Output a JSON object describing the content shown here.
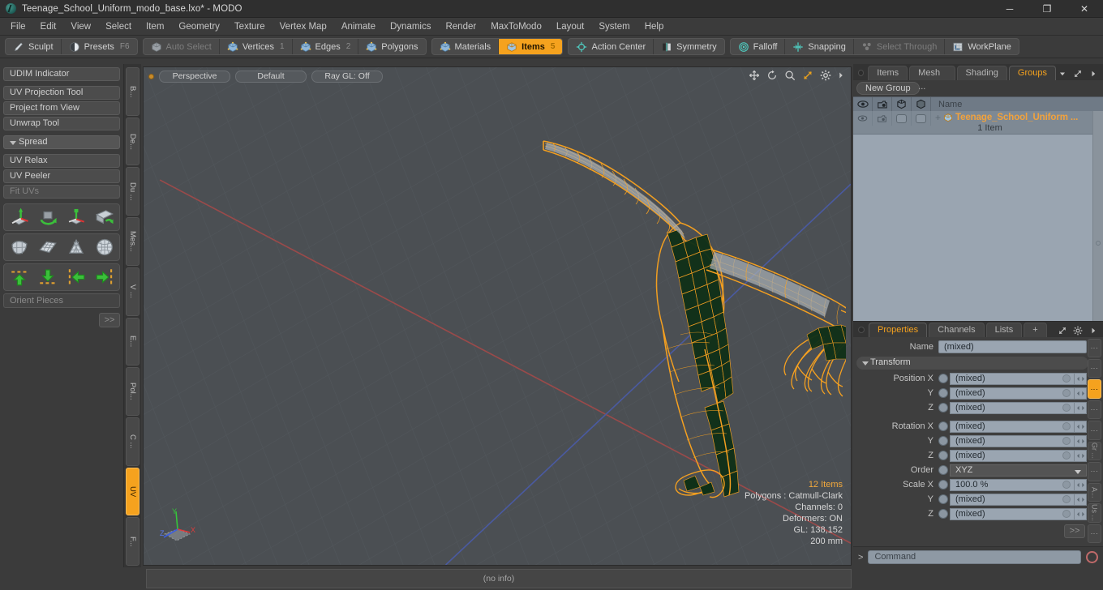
{
  "window": {
    "title": "Teenage_School_Uniform_modo_base.lxo* - MODO",
    "minimize": "─",
    "maximize": "❐",
    "close": "✕"
  },
  "menu": {
    "items": [
      "File",
      "Edit",
      "View",
      "Select",
      "Item",
      "Geometry",
      "Texture",
      "Vertex Map",
      "Animate",
      "Dynamics",
      "Render",
      "MaxToModo",
      "Layout",
      "System",
      "Help"
    ]
  },
  "modebar": {
    "group1": [
      {
        "label": "Sculpt",
        "icon": "brush-icon",
        "state": "normal",
        "count": ""
      },
      {
        "label": "Presets",
        "icon": "sphere-icon",
        "state": "normal",
        "count": "F6"
      }
    ],
    "group2": [
      {
        "label": "Auto Select",
        "icon": "cube-gray-icon",
        "state": "disabled",
        "count": ""
      },
      {
        "label": "Vertices",
        "icon": "cube-blue-icon",
        "state": "normal",
        "count": "1"
      },
      {
        "label": "Edges",
        "icon": "cube-blue-icon",
        "state": "normal",
        "count": "2"
      },
      {
        "label": "Polygons",
        "icon": "cube-blue-icon",
        "state": "normal",
        "count": ""
      }
    ],
    "group3": [
      {
        "label": "Materials",
        "icon": "cube-blue-icon",
        "state": "normal",
        "count": ""
      },
      {
        "label": "Items",
        "icon": "cube-orange-icon",
        "state": "active",
        "count": "5"
      }
    ],
    "group4": [
      {
        "label": "Action Center",
        "icon": "target-icon",
        "state": "normal",
        "count": ""
      },
      {
        "label": "Symmetry",
        "icon": "symmetry-icon",
        "state": "normal",
        "count": ""
      }
    ],
    "group5": [
      {
        "label": "Falloff",
        "icon": "falloff-icon",
        "state": "normal",
        "count": ""
      },
      {
        "label": "Snapping",
        "icon": "snap-icon",
        "state": "normal",
        "count": ""
      },
      {
        "label": "Select Through",
        "icon": "select-through-icon",
        "state": "disabled",
        "count": ""
      },
      {
        "label": "WorkPlane",
        "icon": "workplane-icon",
        "state": "normal",
        "count": ""
      }
    ]
  },
  "left_panel": {
    "buttons": [
      {
        "label": "UDIM Indicator",
        "dim": false,
        "gap_after": true
      },
      {
        "label": "UV Projection Tool",
        "dim": false,
        "gap_after": false
      },
      {
        "label": "Project from View",
        "dim": false,
        "gap_after": false
      },
      {
        "label": "Unwrap Tool",
        "dim": false,
        "gap_after": true
      }
    ],
    "group_header": "Spread",
    "buttons2": [
      {
        "label": "UV Relax",
        "dim": false
      },
      {
        "label": "UV Peeler",
        "dim": false
      },
      {
        "label": "Fit UVs",
        "dim": true
      }
    ],
    "icon_rows": [
      [
        "move-gizmo-icon",
        "rotate-icon",
        "scale-gizmo-icon",
        "fold-icon"
      ],
      [
        "unwrap-mesh-icon",
        "uv-grid-icon",
        "cone-unwrap-icon",
        "sphere-unwrap-icon"
      ],
      [
        "align-up-icon",
        "align-down-icon",
        "align-left-icon",
        "align-right-icon"
      ]
    ],
    "field_placeholder": "Orient Pieces",
    "more_label": ">>",
    "vtabs": [
      {
        "label": "B...",
        "active": false
      },
      {
        "label": "De...",
        "active": false
      },
      {
        "label": "Du ...",
        "active": false
      },
      {
        "label": "Mes...",
        "active": false
      },
      {
        "label": "V ...",
        "active": false
      },
      {
        "label": "E...",
        "active": false
      },
      {
        "label": "Pol...",
        "active": false
      },
      {
        "label": "C ...",
        "active": false
      },
      {
        "label": "UV",
        "active": true
      },
      {
        "label": "F...",
        "active": false
      }
    ]
  },
  "viewport": {
    "view_mode": "Perspective",
    "shading": "Default",
    "raygl": "Ray GL: Off",
    "tools": [
      "move-view-icon",
      "rotate-view-icon",
      "zoom-view-icon",
      "fit-view-icon",
      "gear-icon",
      "chevron-right-icon"
    ],
    "stats": {
      "items": "12 Items",
      "polygons": "Polygons : Catmull-Clark",
      "channels": "Channels: 0",
      "deformers": "Deformers: ON",
      "gl": "GL: 138,152",
      "scale": "200 mm"
    },
    "axis": {
      "x": "X",
      "y": "Y",
      "z": "Z"
    }
  },
  "right_panel": {
    "top_tabs": [
      {
        "label": "Items",
        "active": false
      },
      {
        "label": "Mesh ...",
        "active": false
      },
      {
        "label": "Shading",
        "active": false
      },
      {
        "label": "Groups",
        "active": true
      }
    ],
    "top_tab_extras": [
      "chevron-down-icon",
      "expand-icon",
      "chevron-right-icon"
    ],
    "new_group_label": "New Group",
    "list": {
      "columns": [
        "eye-icon",
        "render-icon",
        "wire-icon",
        "shade-icon",
        "Name"
      ],
      "name_header": "Name",
      "rows": [
        {
          "name": "Teenage_School_Uniform ...",
          "sub": "1 Item",
          "expander": "+"
        }
      ]
    },
    "bottom_tabs": [
      {
        "label": "Properties",
        "active": true
      },
      {
        "label": "Channels",
        "active": false
      },
      {
        "label": "Lists",
        "active": false
      },
      {
        "label": "+",
        "active": false
      }
    ],
    "bottom_tab_extras": [
      "expand-icon",
      "gear-icon",
      "chevron-right-icon"
    ],
    "properties": {
      "name_label": "Name",
      "name_value": "(mixed)",
      "transform_header": "Transform",
      "rows": [
        {
          "label": "Position X",
          "value": "(mixed)",
          "type": "value"
        },
        {
          "label": "Y",
          "value": "(mixed)",
          "type": "value"
        },
        {
          "label": "Z",
          "value": "(mixed)",
          "type": "value"
        },
        {
          "label": "Rotation X",
          "value": "(mixed)",
          "type": "value",
          "spacer_before": true
        },
        {
          "label": "Y",
          "value": "(mixed)",
          "type": "value"
        },
        {
          "label": "Z",
          "value": "(mixed)",
          "type": "value"
        },
        {
          "label": "Order",
          "value": "XYZ",
          "type": "select"
        },
        {
          "label": "Scale X",
          "value": "100.0 %",
          "type": "value"
        },
        {
          "label": "Y",
          "value": "(mixed)",
          "type": "value"
        },
        {
          "label": "Z",
          "value": "(mixed)",
          "type": "value"
        }
      ],
      "more_label": ">>"
    },
    "vtabs": [
      {
        "label": "⋮",
        "active": false
      },
      {
        "label": "⋮",
        "active": false
      },
      {
        "label": "⋮",
        "active": true
      },
      {
        "label": "⋮",
        "active": false
      },
      {
        "label": "⋮",
        "active": false
      },
      {
        "label": "Gr ...",
        "active": false
      },
      {
        "label": "⋮",
        "active": false
      },
      {
        "label": "A...",
        "active": false
      },
      {
        "label": "Us ...",
        "active": false
      },
      {
        "label": "⋮",
        "active": false
      }
    ]
  },
  "command_bar": {
    "caret": ">",
    "placeholder": "Command",
    "record_icon": "record-icon"
  },
  "statusbar": {
    "info": "(no info)"
  },
  "colors": {
    "accent": "#f5a21e",
    "panel": "#3b3b3b",
    "viewport": "#4b4f53",
    "list_bg": "#9aa5b1",
    "wire": "#f5a020"
  }
}
